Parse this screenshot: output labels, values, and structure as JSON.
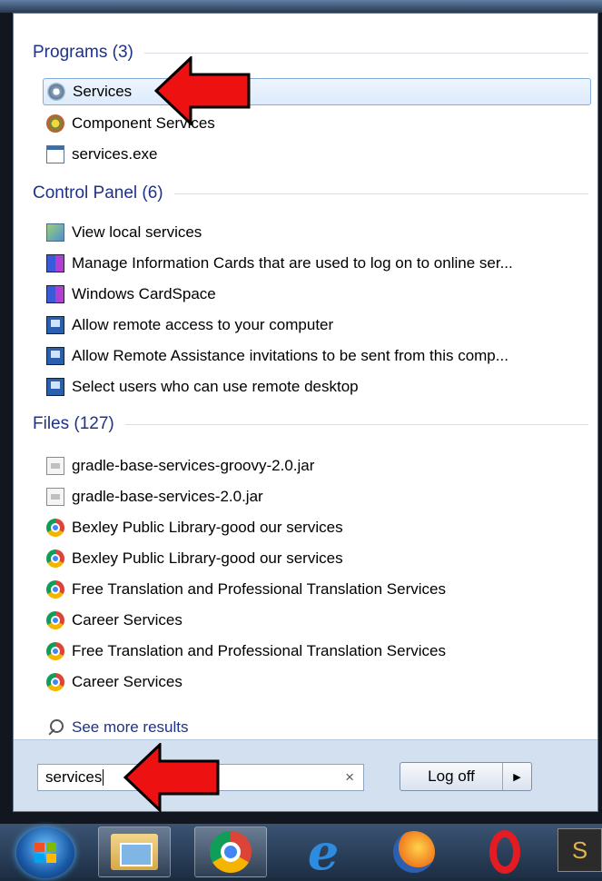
{
  "sections": {
    "programs": "Programs (3)",
    "control_panel": "Control Panel (6)",
    "files": "Files (127)"
  },
  "programs": [
    {
      "label": "Services",
      "icon": "services-gear-icon",
      "selected": true
    },
    {
      "label": "Component Services",
      "icon": "component-services-icon"
    },
    {
      "label": "services.exe",
      "icon": "window-app-icon"
    }
  ],
  "control_panel": [
    {
      "label": "View local services",
      "icon": "control-panel-icon"
    },
    {
      "label": "Manage Information Cards that are used to log on to online ser...",
      "icon": "cardspace-icon"
    },
    {
      "label": "Windows CardSpace",
      "icon": "cardspace-icon"
    },
    {
      "label": "Allow remote access to your computer",
      "icon": "remote-desktop-icon"
    },
    {
      "label": "Allow Remote Assistance invitations to be sent from this comp...",
      "icon": "remote-desktop-icon"
    },
    {
      "label": "Select users who can use remote desktop",
      "icon": "remote-desktop-icon"
    }
  ],
  "files": [
    {
      "label": "gradle-base-services-groovy-2.0.jar",
      "icon": "jar-file-icon"
    },
    {
      "label": "gradle-base-services-2.0.jar",
      "icon": "jar-file-icon"
    },
    {
      "label": "Bexley Public Library-good our services",
      "icon": "chrome-icon"
    },
    {
      "label": "Bexley Public Library-good our services",
      "icon": "chrome-icon"
    },
    {
      "label": "Free Translation and Professional Translation Services",
      "icon": "chrome-icon"
    },
    {
      "label": "Career Services",
      "icon": "chrome-icon"
    },
    {
      "label": "Free Translation and Professional Translation Services",
      "icon": "chrome-icon"
    },
    {
      "label": "Career Services",
      "icon": "chrome-icon"
    }
  ],
  "see_more": "See more results",
  "search": {
    "value": "services",
    "clear": "×"
  },
  "log_off": {
    "label": "Log off",
    "arrow": "▶"
  },
  "taskbar": {
    "last_button": "S"
  },
  "colors": {
    "section_header": "#1e3287",
    "selected_bg": "#dcebfc",
    "arrow_red": "#ee1111"
  }
}
